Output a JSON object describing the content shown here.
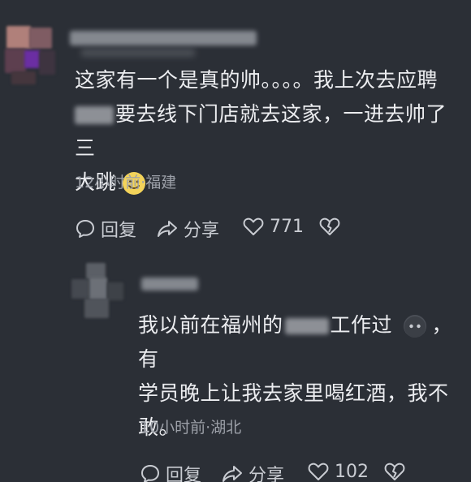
{
  "comment1": {
    "text_line1": "这家有一个是真的帅。。。。我上次去应聘",
    "text_line2": "要去线下门店就去这家，一进去帅了三",
    "text_line3": "大跳",
    "meta": "12小时前·福建",
    "reply_label": "回复",
    "share_label": "分享",
    "likes": "771",
    "emoji_icon": "smile-emoji-icon"
  },
  "reply1": {
    "text_line1_a": "我以前在福州的",
    "text_line1_b": "工作过",
    "text_line1_c": "，有",
    "text_line2": "学员晚上让我去家里喝红酒，我不",
    "text_line3": "敢。",
    "meta": "10小时前·湖北",
    "reply_label": "回复",
    "share_label": "分享",
    "likes": "102",
    "emoji_icon": "dark-face-emoji-icon"
  },
  "colors": {
    "background": "#2b2f36",
    "text": "#ecedf0",
    "meta": "#9ca0a8",
    "emoji_yellow": "#f3d35a"
  }
}
